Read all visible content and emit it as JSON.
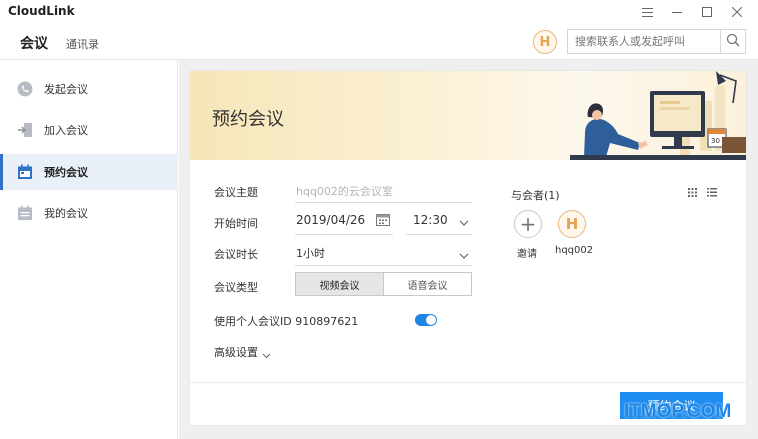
{
  "app": {
    "title": "CloudLink"
  },
  "header": {
    "tabs": [
      {
        "label": "会议"
      },
      {
        "label": "通讯录"
      }
    ],
    "avatar_letter": "H",
    "search_placeholder": "搜索联系人或发起呼叫"
  },
  "sidebar": {
    "items": [
      {
        "label": "发起会议",
        "icon": "phone-icon",
        "active": false
      },
      {
        "label": "加入会议",
        "icon": "join-door-icon",
        "active": false
      },
      {
        "label": "预约会议",
        "icon": "calendar-icon",
        "active": true
      },
      {
        "label": "我的会议",
        "icon": "calendar-list-icon",
        "active": false
      }
    ]
  },
  "card": {
    "title": "预约会议",
    "form": {
      "subject_label": "会议主题",
      "subject_placeholder": "hqq002的云会议室",
      "start_label": "开始时间",
      "start_date": "2019/04/26",
      "start_time": "12:30",
      "duration_label": "会议时长",
      "duration_value": "1小时",
      "type_label": "会议类型",
      "type_options": [
        "视频会议",
        "语音会议"
      ],
      "type_selected": "视频会议",
      "personal_id_label": "使用个人会议ID 910897621",
      "personal_id_enabled": true,
      "advanced_label": "高级设置"
    },
    "participants": {
      "label": "与会者(1)",
      "invite_label": "邀请",
      "members": [
        {
          "name": "hqq002",
          "avatar_letter": "H"
        }
      ]
    },
    "submit_label": "预约会议"
  },
  "watermark": "ITMOP.COM",
  "colors": {
    "accent": "#1f8df0",
    "avatar_border": "#e8b882",
    "sidebar_active_bg": "#eaf0f8"
  }
}
